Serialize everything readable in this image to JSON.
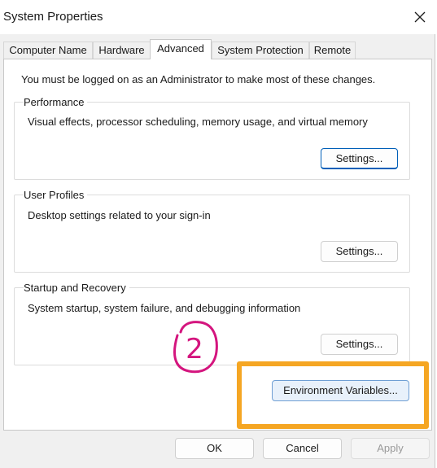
{
  "window": {
    "title": "System Properties",
    "close_icon": "close-icon"
  },
  "tabs": [
    {
      "label": "Computer Name",
      "active": false
    },
    {
      "label": "Hardware",
      "active": false
    },
    {
      "label": "Advanced",
      "active": true
    },
    {
      "label": "System Protection",
      "active": false
    },
    {
      "label": "Remote",
      "active": false
    }
  ],
  "advanced": {
    "admin_note": "You must be logged on as an Administrator to make most of these changes.",
    "performance": {
      "label": "Performance",
      "description": "Visual effects, processor scheduling, memory usage, and virtual memory",
      "button": "Settings..."
    },
    "user_profiles": {
      "label": "User Profiles",
      "description": "Desktop settings related to your sign-in",
      "button": "Settings..."
    },
    "startup_recovery": {
      "label": "Startup and Recovery",
      "description": "System startup, system failure, and debugging information",
      "button": "Settings..."
    },
    "environment_button": "Environment Variables..."
  },
  "footer": {
    "ok": "OK",
    "cancel": "Cancel",
    "apply": "Apply"
  },
  "annotations": {
    "step_number": "2",
    "step_color": "#d4157e",
    "highlight_color": "#f5a623"
  }
}
